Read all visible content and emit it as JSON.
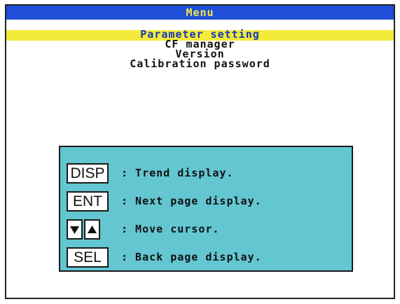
{
  "header": {
    "title": "Menu"
  },
  "menu": {
    "items": [
      {
        "label": "Parameter setting",
        "selected": true
      },
      {
        "label": "CF manager",
        "selected": false
      },
      {
        "label": "Version",
        "selected": false
      },
      {
        "label": "Calibration password",
        "selected": false
      }
    ]
  },
  "help": {
    "rows": [
      {
        "key": "DISP",
        "desc": ": Trend display."
      },
      {
        "key": "ENT",
        "desc": ": Next page display."
      },
      {
        "keys": [
          "down-arrow-icon",
          "up-arrow-icon"
        ],
        "desc": ": Move cursor."
      },
      {
        "key": "SEL",
        "desc": ": Back page display."
      }
    ]
  },
  "colors": {
    "title_bar_bg": "#1f4ed8",
    "title_text": "#f2e84a",
    "highlight": "#f3ea3a",
    "selected_text": "#1737b8",
    "help_bg": "#63c6d1"
  }
}
